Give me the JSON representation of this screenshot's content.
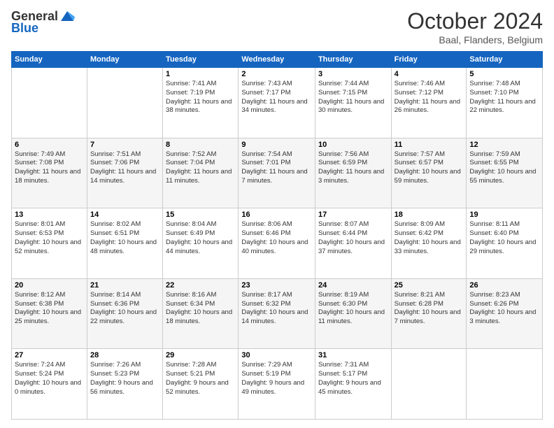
{
  "header": {
    "logo_general": "General",
    "logo_blue": "Blue",
    "month": "October 2024",
    "location": "Baal, Flanders, Belgium"
  },
  "weekdays": [
    "Sunday",
    "Monday",
    "Tuesday",
    "Wednesday",
    "Thursday",
    "Friday",
    "Saturday"
  ],
  "weeks": [
    [
      {
        "day": "",
        "info": ""
      },
      {
        "day": "",
        "info": ""
      },
      {
        "day": "1",
        "info": "Sunrise: 7:41 AM\nSunset: 7:19 PM\nDaylight: 11 hours and 38 minutes."
      },
      {
        "day": "2",
        "info": "Sunrise: 7:43 AM\nSunset: 7:17 PM\nDaylight: 11 hours and 34 minutes."
      },
      {
        "day": "3",
        "info": "Sunrise: 7:44 AM\nSunset: 7:15 PM\nDaylight: 11 hours and 30 minutes."
      },
      {
        "day": "4",
        "info": "Sunrise: 7:46 AM\nSunset: 7:12 PM\nDaylight: 11 hours and 26 minutes."
      },
      {
        "day": "5",
        "info": "Sunrise: 7:48 AM\nSunset: 7:10 PM\nDaylight: 11 hours and 22 minutes."
      }
    ],
    [
      {
        "day": "6",
        "info": "Sunrise: 7:49 AM\nSunset: 7:08 PM\nDaylight: 11 hours and 18 minutes."
      },
      {
        "day": "7",
        "info": "Sunrise: 7:51 AM\nSunset: 7:06 PM\nDaylight: 11 hours and 14 minutes."
      },
      {
        "day": "8",
        "info": "Sunrise: 7:52 AM\nSunset: 7:04 PM\nDaylight: 11 hours and 11 minutes."
      },
      {
        "day": "9",
        "info": "Sunrise: 7:54 AM\nSunset: 7:01 PM\nDaylight: 11 hours and 7 minutes."
      },
      {
        "day": "10",
        "info": "Sunrise: 7:56 AM\nSunset: 6:59 PM\nDaylight: 11 hours and 3 minutes."
      },
      {
        "day": "11",
        "info": "Sunrise: 7:57 AM\nSunset: 6:57 PM\nDaylight: 10 hours and 59 minutes."
      },
      {
        "day": "12",
        "info": "Sunrise: 7:59 AM\nSunset: 6:55 PM\nDaylight: 10 hours and 55 minutes."
      }
    ],
    [
      {
        "day": "13",
        "info": "Sunrise: 8:01 AM\nSunset: 6:53 PM\nDaylight: 10 hours and 52 minutes."
      },
      {
        "day": "14",
        "info": "Sunrise: 8:02 AM\nSunset: 6:51 PM\nDaylight: 10 hours and 48 minutes."
      },
      {
        "day": "15",
        "info": "Sunrise: 8:04 AM\nSunset: 6:49 PM\nDaylight: 10 hours and 44 minutes."
      },
      {
        "day": "16",
        "info": "Sunrise: 8:06 AM\nSunset: 6:46 PM\nDaylight: 10 hours and 40 minutes."
      },
      {
        "day": "17",
        "info": "Sunrise: 8:07 AM\nSunset: 6:44 PM\nDaylight: 10 hours and 37 minutes."
      },
      {
        "day": "18",
        "info": "Sunrise: 8:09 AM\nSunset: 6:42 PM\nDaylight: 10 hours and 33 minutes."
      },
      {
        "day": "19",
        "info": "Sunrise: 8:11 AM\nSunset: 6:40 PM\nDaylight: 10 hours and 29 minutes."
      }
    ],
    [
      {
        "day": "20",
        "info": "Sunrise: 8:12 AM\nSunset: 6:38 PM\nDaylight: 10 hours and 25 minutes."
      },
      {
        "day": "21",
        "info": "Sunrise: 8:14 AM\nSunset: 6:36 PM\nDaylight: 10 hours and 22 minutes."
      },
      {
        "day": "22",
        "info": "Sunrise: 8:16 AM\nSunset: 6:34 PM\nDaylight: 10 hours and 18 minutes."
      },
      {
        "day": "23",
        "info": "Sunrise: 8:17 AM\nSunset: 6:32 PM\nDaylight: 10 hours and 14 minutes."
      },
      {
        "day": "24",
        "info": "Sunrise: 8:19 AM\nSunset: 6:30 PM\nDaylight: 10 hours and 11 minutes."
      },
      {
        "day": "25",
        "info": "Sunrise: 8:21 AM\nSunset: 6:28 PM\nDaylight: 10 hours and 7 minutes."
      },
      {
        "day": "26",
        "info": "Sunrise: 8:23 AM\nSunset: 6:26 PM\nDaylight: 10 hours and 3 minutes."
      }
    ],
    [
      {
        "day": "27",
        "info": "Sunrise: 7:24 AM\nSunset: 5:24 PM\nDaylight: 10 hours and 0 minutes."
      },
      {
        "day": "28",
        "info": "Sunrise: 7:26 AM\nSunset: 5:23 PM\nDaylight: 9 hours and 56 minutes."
      },
      {
        "day": "29",
        "info": "Sunrise: 7:28 AM\nSunset: 5:21 PM\nDaylight: 9 hours and 52 minutes."
      },
      {
        "day": "30",
        "info": "Sunrise: 7:29 AM\nSunset: 5:19 PM\nDaylight: 9 hours and 49 minutes."
      },
      {
        "day": "31",
        "info": "Sunrise: 7:31 AM\nSunset: 5:17 PM\nDaylight: 9 hours and 45 minutes."
      },
      {
        "day": "",
        "info": ""
      },
      {
        "day": "",
        "info": ""
      }
    ]
  ]
}
